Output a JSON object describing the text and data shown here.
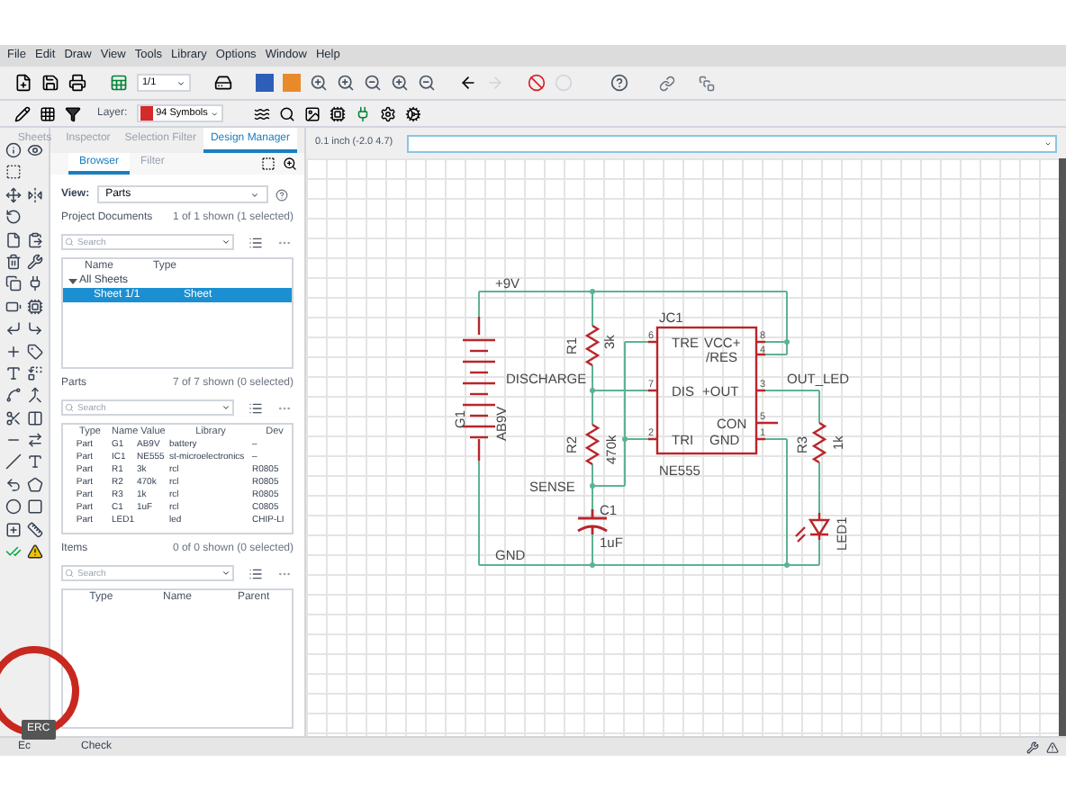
{
  "menu": [
    "File",
    "Edit",
    "Draw",
    "View",
    "Tools",
    "Library",
    "Options",
    "Window",
    "Help"
  ],
  "toolbar": {
    "sheet": "1/1",
    "layer_label": "Layer:",
    "layer": {
      "name": "94 Symbols",
      "color": "#d42a2a"
    }
  },
  "tabs": [
    {
      "label": "Sheets",
      "selected": false
    },
    {
      "label": "Inspector",
      "selected": false
    },
    {
      "label": "Selection Filter",
      "selected": false
    },
    {
      "label": "Design Manager",
      "selected": true
    }
  ],
  "subtabs": [
    {
      "label": "Browser",
      "selected": true
    },
    {
      "label": "Filter",
      "selected": false
    }
  ],
  "view": {
    "label": "View:",
    "value": "Parts"
  },
  "project_documents": {
    "title": "Project Documents",
    "count": "1 of 1 shown (1 selected)",
    "search": {
      "placeholder": "Search"
    },
    "columns": [
      "Name",
      "Type"
    ],
    "tree": [
      {
        "name": "All Sheets",
        "expanded": true,
        "selected": false,
        "children": [
          {
            "name": "Sheet 1/1",
            "type": "Sheet",
            "selected": true
          }
        ]
      }
    ]
  },
  "parts": {
    "title": "Parts",
    "count": "7 of 7 shown (0 selected)",
    "search": {
      "placeholder": "Search"
    },
    "columns": [
      "Type",
      "Name",
      "Value",
      "Library",
      "Dev"
    ],
    "rows": [
      {
        "type": "Part",
        "name": "G1",
        "value": "AB9V",
        "library": "battery",
        "dev": "–"
      },
      {
        "type": "Part",
        "name": "IC1",
        "value": "NE555",
        "library": "st-microelectronics",
        "dev": "–"
      },
      {
        "type": "Part",
        "name": "R1",
        "value": "3k",
        "library": "rcl",
        "dev": "R0805"
      },
      {
        "type": "Part",
        "name": "R2",
        "value": "470k",
        "library": "rcl",
        "dev": "R0805"
      },
      {
        "type": "Part",
        "name": "R3",
        "value": "1k",
        "library": "rcl",
        "dev": "R0805"
      },
      {
        "type": "Part",
        "name": "C1",
        "value": "1uF",
        "library": "rcl",
        "dev": "C0805"
      },
      {
        "type": "Part",
        "name": "LED1",
        "library": "led",
        "dev": "CHIP-LI"
      }
    ]
  },
  "items": {
    "title": "Items",
    "count": "0 of 0 shown (0 selected)",
    "search": {
      "placeholder": "Search"
    },
    "columns": [
      "Type",
      "Name",
      "Parent"
    ]
  },
  "command": {
    "coordinates": "0.1 inch (-2.0 4.7)"
  },
  "schematic": {
    "labels": [
      "+9V",
      "JC1",
      "TRE",
      "VCC+",
      "/RES",
      "DIS",
      "+OUT",
      "CON",
      "TRI",
      "GND",
      "NE555",
      "R1",
      "3k",
      "DISCHARGE",
      "R2",
      "470k",
      "SENSE",
      "C1",
      "1uF",
      "G1",
      "AB9V",
      "OUT_LED",
      "R3",
      "1k",
      "LED1",
      "GND"
    ],
    "pins": [
      "6",
      "7",
      "2",
      "8",
      "4",
      "3",
      "5",
      "1"
    ]
  },
  "tooltip": "ERC",
  "status_bar": {
    "texts": [
      "Ec",
      "Check"
    ]
  }
}
